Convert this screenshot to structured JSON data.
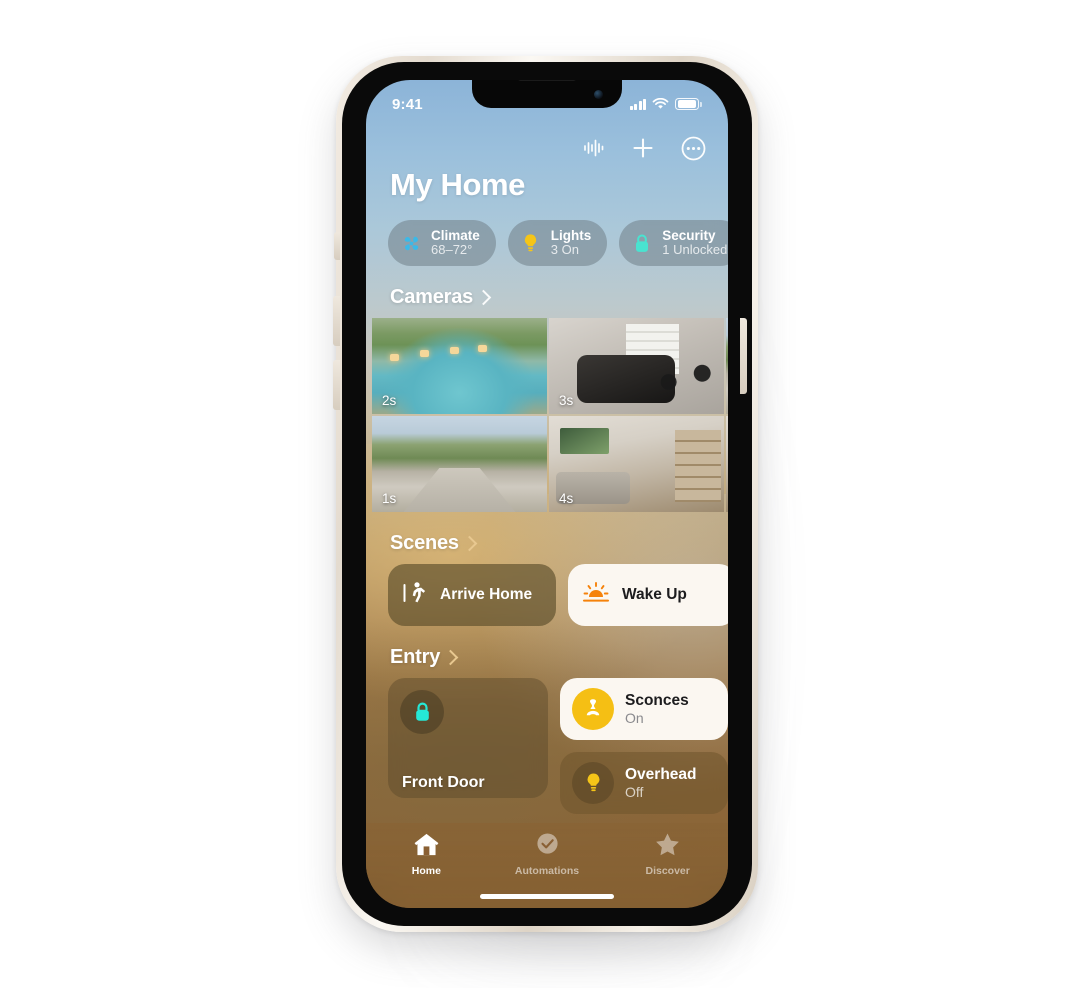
{
  "status_bar": {
    "time": "9:41",
    "cellular_icon": "signal-bars-icon",
    "wifi_icon": "wifi-icon",
    "battery_icon": "battery-icon"
  },
  "nav": {
    "siri_icon": "waveform-icon",
    "add_icon": "plus-icon",
    "more_icon": "ellipsis-circle-icon"
  },
  "header": {
    "title": "My Home"
  },
  "status_chips": [
    {
      "icon": "fan-icon",
      "title": "Climate",
      "subtitle": "68–72°",
      "color": "#3bb9e8"
    },
    {
      "icon": "bulb-icon",
      "title": "Lights",
      "subtitle": "3 On",
      "color": "#f5c518"
    },
    {
      "icon": "lock-icon",
      "title": "Security",
      "subtitle": "1 Unlocked",
      "color": "#49e3d0"
    }
  ],
  "sections": {
    "cameras": {
      "title": "Cameras",
      "chevron_icon": "chevron-right-icon",
      "tiles": [
        {
          "name": "pool-camera",
          "stamp": "2s"
        },
        {
          "name": "garage-camera",
          "stamp": "3s"
        },
        {
          "name": "driveway-camera",
          "stamp": "1s"
        },
        {
          "name": "living-room-camera",
          "stamp": "4s"
        }
      ]
    },
    "scenes": {
      "title": "Scenes",
      "chevron_icon": "chevron-right-icon",
      "tiles": [
        {
          "label": "Arrive Home",
          "icon": "walking-person-icon",
          "state": "inactive"
        },
        {
          "label": "Wake Up",
          "icon": "sunrise-icon",
          "state": "active"
        }
      ]
    },
    "entry": {
      "title": "Entry",
      "chevron_icon": "chevron-right-icon",
      "accessories": [
        {
          "name": "Front Door",
          "state": "",
          "icon": "lock-icon",
          "status": "locked"
        },
        {
          "name": "Sconces",
          "state": "On",
          "icon": "sconce-light-icon",
          "status": "on"
        },
        {
          "name": "Overhead",
          "state": "Off",
          "icon": "bulb-icon",
          "status": "off"
        }
      ]
    }
  },
  "tab_bar": [
    {
      "label": "Home",
      "icon": "house-icon",
      "active": true
    },
    {
      "label": "Automations",
      "icon": "clock-check-icon",
      "active": false
    },
    {
      "label": "Discover",
      "icon": "star-icon",
      "active": false
    }
  ]
}
